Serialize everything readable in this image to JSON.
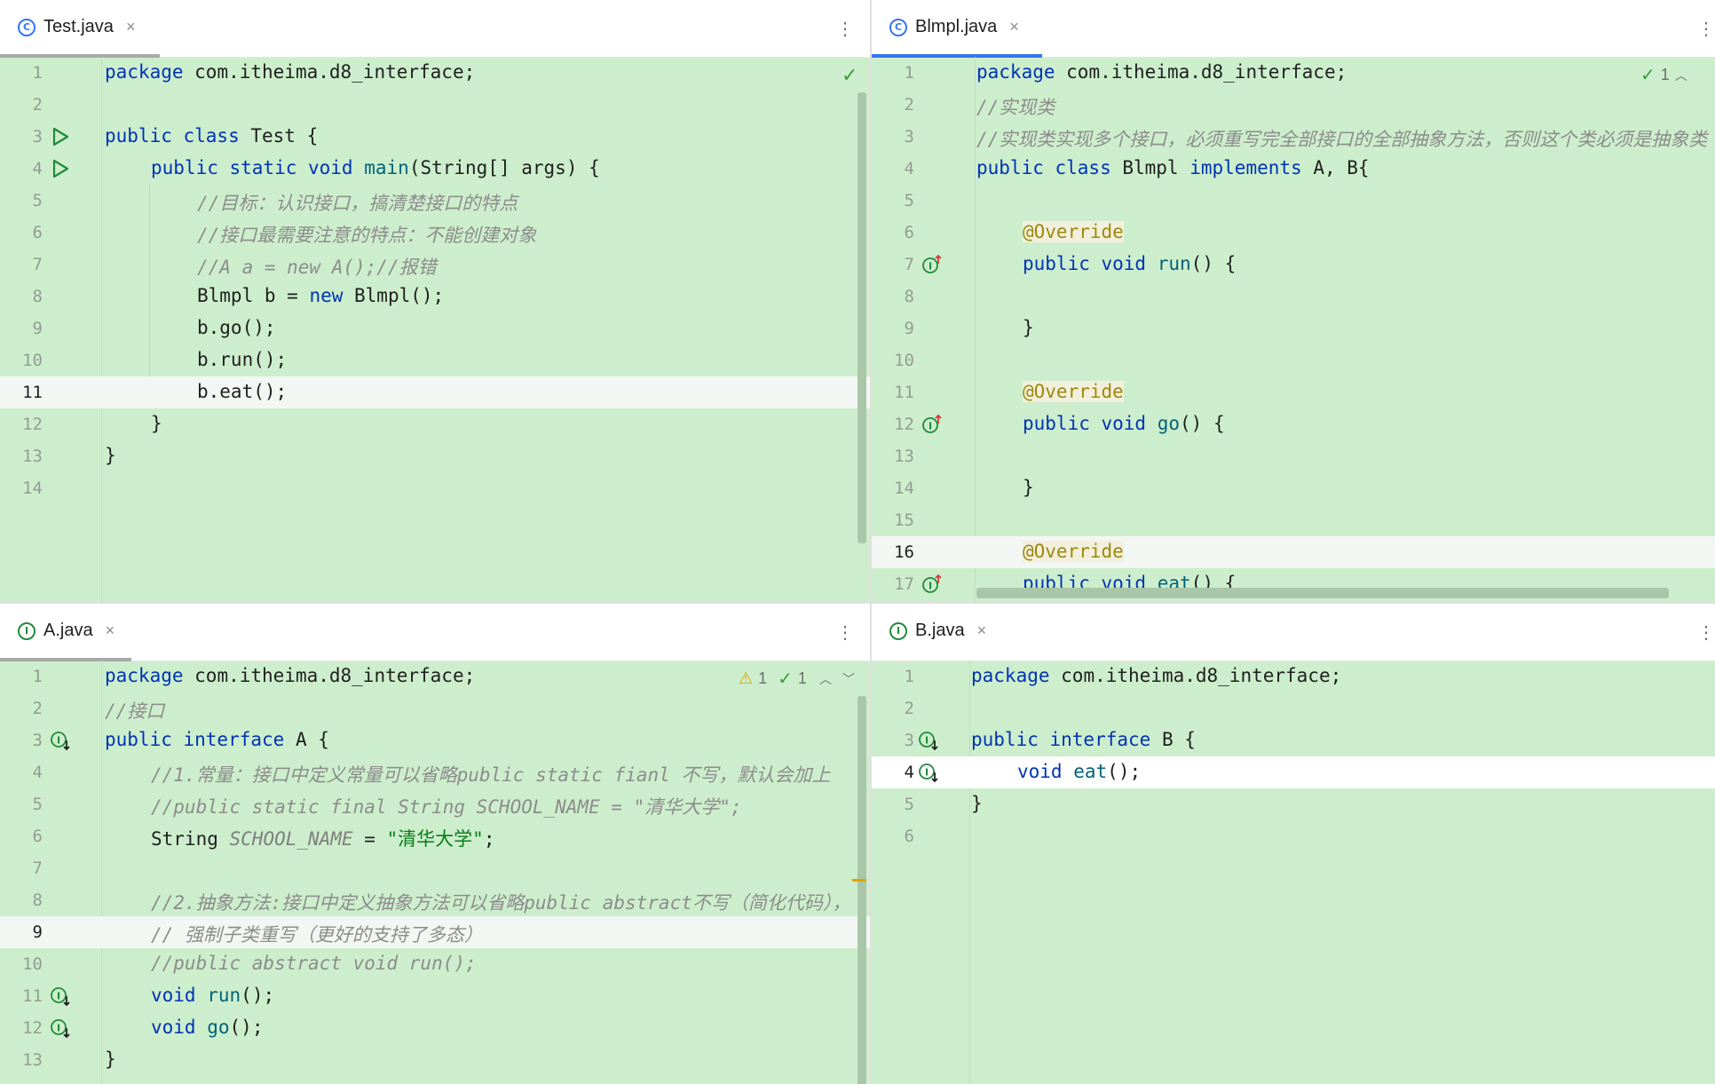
{
  "panes": {
    "test": {
      "tab": {
        "name": "Test.java",
        "icon": "class-icon",
        "close": "×",
        "menu": "⋮"
      },
      "lines": [
        "1",
        "2",
        "3",
        "4",
        "5",
        "6",
        "7",
        "8",
        "9",
        "10",
        "11",
        "12",
        "13",
        "14"
      ],
      "status": "✓"
    },
    "bimpl": {
      "tab": {
        "name": "Blmpl.java",
        "icon": "class-icon",
        "close": "×",
        "menu": "⋮"
      },
      "lines": [
        "1",
        "2",
        "3",
        "4",
        "5",
        "6",
        "7",
        "8",
        "9",
        "10",
        "11",
        "12",
        "13",
        "14",
        "15",
        "16",
        "17"
      ],
      "status_count": "1"
    },
    "a": {
      "tab": {
        "name": "A.java",
        "icon": "interface-icon",
        "close": "×",
        "menu": "⋮"
      },
      "lines": [
        "1",
        "2",
        "3",
        "4",
        "5",
        "6",
        "7",
        "8",
        "9",
        "10",
        "11",
        "12",
        "13"
      ],
      "warn_count": "1",
      "ok_count": "1"
    },
    "b": {
      "tab": {
        "name": "B.java",
        "icon": "interface-icon",
        "close": "×",
        "menu": "⋮"
      },
      "lines": [
        "1",
        "2",
        "3",
        "4",
        "5",
        "6"
      ]
    }
  },
  "code": {
    "test": {
      "l1_kw": "package",
      "l1_rest": " com.itheima.d8_interface;",
      "l3_kw": "public class",
      "l3_rest": " Test {",
      "l4_kw": "public static void",
      "l4_fn": "main",
      "l4_rest": "(String[] args) {",
      "l5": "//目标：认识接口，搞清楚接口的特点",
      "l6": "//接口最需要注意的特点：不能创建对象",
      "l7": "//A a = new A();//报错",
      "l8_a": "Blmpl b = ",
      "l8_kw": "new",
      "l8_b": " Blmpl();",
      "l9": "b.go();",
      "l10": "b.run();",
      "l11": "b.eat();",
      "l12": "}",
      "l13": "}"
    },
    "bimpl": {
      "l1_kw": "package",
      "l1_rest": " com.itheima.d8_interface;",
      "l2": "//实现类",
      "l3": "//实现类实现多个接口，必须重写完全部接口的全部抽象方法，否则这个类必须是抽象类",
      "l4_kw1": "public class",
      "l4_mid": " Blmpl ",
      "l4_kw2": "implements",
      "l4_rest": " A, B{",
      "ann": "@Override",
      "kw_pv": "public void",
      "run": "run",
      "go": "go",
      "eat": "eat",
      "sig_rest": "() {",
      "close": "}"
    },
    "a": {
      "l1_kw": "package",
      "l1_rest": " com.itheima.d8_interface;",
      "l2": "//接口",
      "l3_kw": "public interface",
      "l3_rest": " A {",
      "l4": "//1.常量：接口中定义常量可以省略public static fianl 不写，默认会加上",
      "l5": "//public static final String SCHOOL_NAME = \"清华大学\";",
      "l6_a": "String ",
      "l6_f": "SCHOOL_NAME",
      "l6_b": " = ",
      "l6_s": "\"清华大学\"",
      "l6_c": ";",
      "l8": "//2.抽象方法:接口中定义抽象方法可以省略public abstract不写（简化代码），",
      "l9": "// 强制子类重写（更好的支持了多态）",
      "l10": "//public abstract void run();",
      "kw_void": "void",
      "run": "run",
      "go": "go",
      "call_end": "();",
      "l13": "}"
    },
    "b": {
      "l1_kw": "package",
      "l1_rest": " com.itheima.d8_interface;",
      "l3_kw": "public interface",
      "l3_rest": " B {",
      "l4_kw": "void",
      "l4_fn": "eat",
      "l4_rest": "();",
      "l5": "}"
    }
  },
  "colors": {
    "editor_bg": "#cdeecc",
    "keyword": "#0033b3",
    "comment": "#8c8c8c",
    "accent": "#3574f0"
  }
}
